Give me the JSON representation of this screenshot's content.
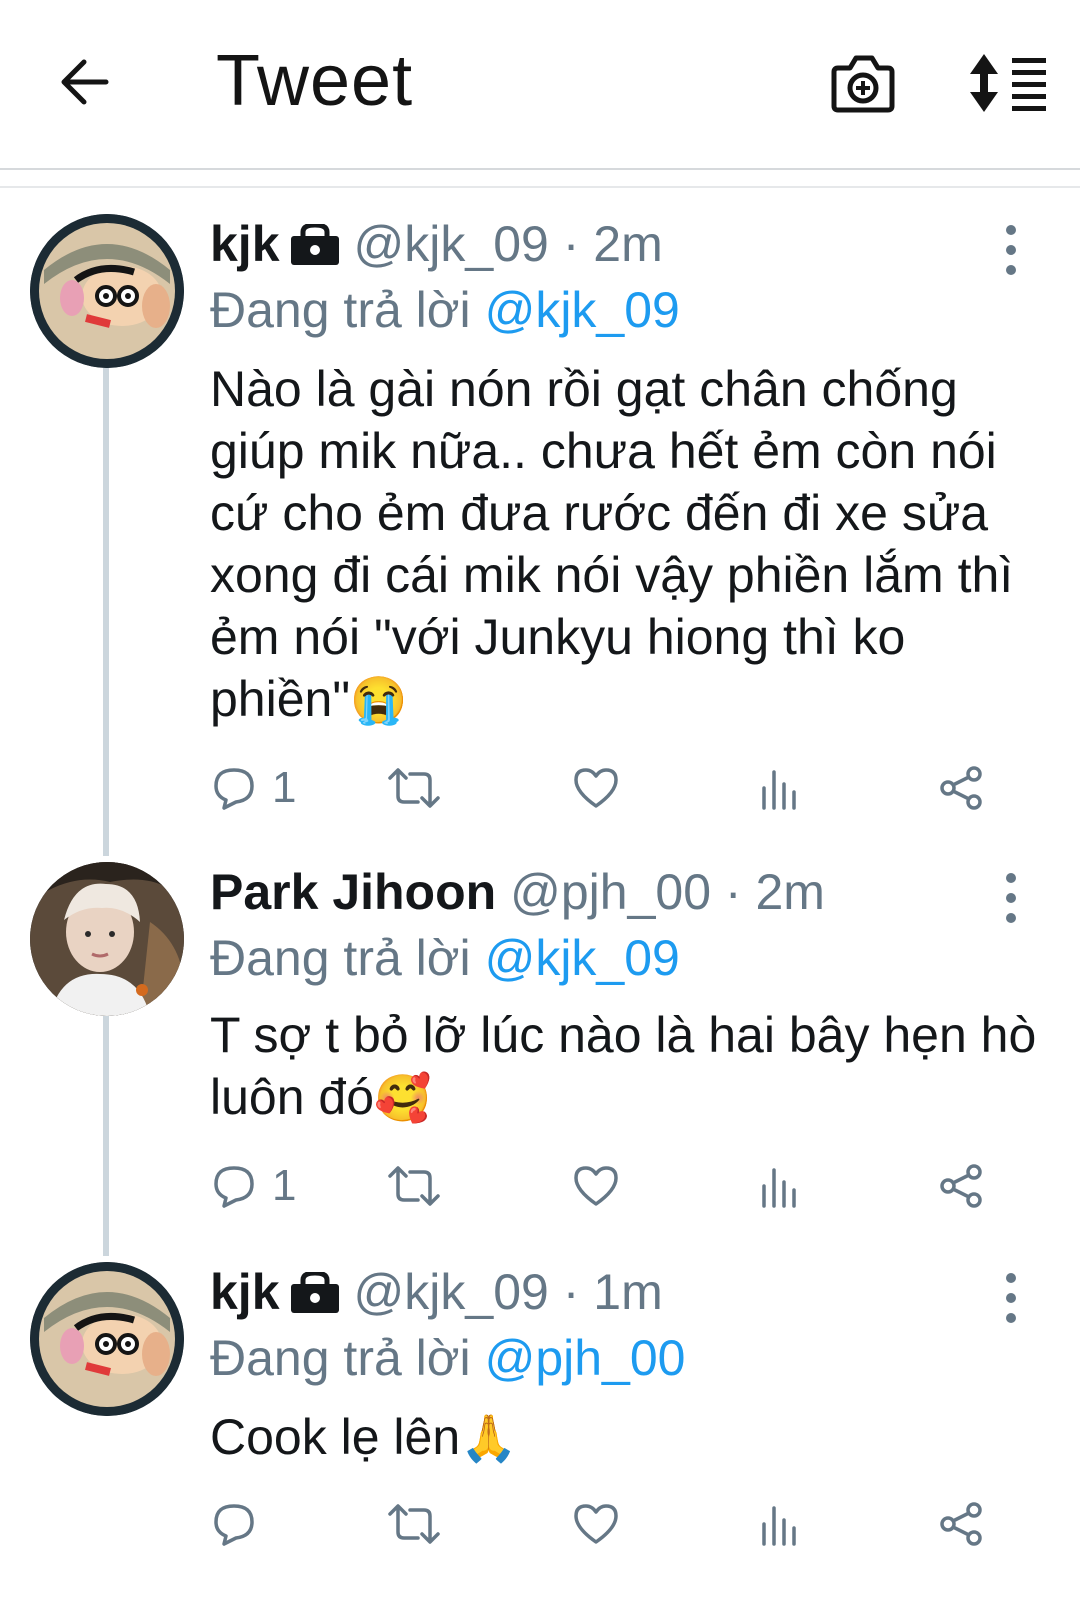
{
  "header": {
    "title": "Tweet"
  },
  "tweets": [
    {
      "name": "kjk",
      "handle": "@kjk_09",
      "separator": "·",
      "time": "2m",
      "reply_prefix": "Đang trả lời ",
      "reply_to": "@kjk_09",
      "text": "Nào là gài nón rồi gạt chân chống giúp mik nữa.. chưa hết ẻm còn nói cứ cho ẻm đưa rước đến đi xe sửa xong đi cái mik nói vậy phiền lắm thì ẻm nói \"với Junkyu hiong thì ko phiền\"",
      "emoji": "😭",
      "reply_count": "1",
      "locked": true
    },
    {
      "name": "Park Jihoon",
      "handle": "@pjh_00",
      "separator": "·",
      "time": "2m",
      "reply_prefix": "Đang trả lời ",
      "reply_to": "@kjk_09",
      "text": "T sợ t bỏ lỡ lúc nào là hai bây hẹn hò luôn đó",
      "emoji": "🥰",
      "reply_count": "1",
      "locked": false
    },
    {
      "name": "kjk",
      "handle": "@kjk_09",
      "separator": "·",
      "time": "1m",
      "reply_prefix": "Đang trả lời ",
      "reply_to": "@pjh_00",
      "text": "Cook lẹ lên",
      "emoji": "🙏",
      "reply_count": "",
      "locked": true
    }
  ],
  "icons": {
    "back": "arrow-left-icon",
    "camera": "camera-icon",
    "sort": "sort-icon",
    "more": "more-vertical-icon",
    "reply": "reply-icon",
    "retweet": "retweet-icon",
    "like": "heart-icon",
    "analytics": "analytics-icon",
    "share": "share-icon"
  },
  "colors": {
    "accent": "#1d9bf0",
    "secondary_text": "#657786",
    "thread_line": "#ccd6dd"
  }
}
